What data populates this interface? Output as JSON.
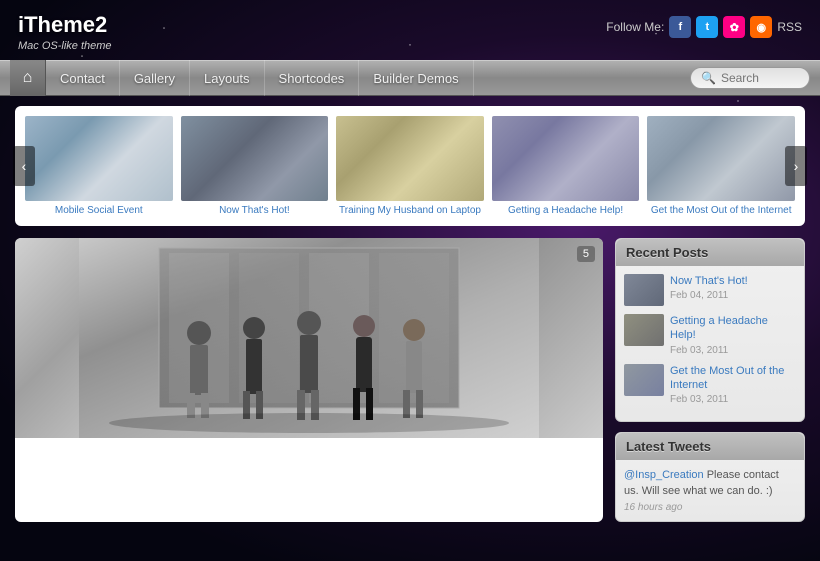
{
  "site": {
    "title": "iTheme2",
    "tagline": "Mac OS-like theme"
  },
  "header": {
    "follow_label": "Follow Me:",
    "social": [
      {
        "name": "Facebook",
        "key": "fb",
        "icon": "f"
      },
      {
        "name": "Twitter",
        "key": "tw",
        "icon": "t"
      },
      {
        "name": "Flickr",
        "key": "fl",
        "icon": "✿"
      },
      {
        "name": "RSS Feed",
        "key": "rss",
        "icon": "◉"
      }
    ],
    "rss_label": "RSS"
  },
  "nav": {
    "home_icon": "⌂",
    "items": [
      "Contact",
      "Gallery",
      "Layouts",
      "Shortcodes",
      "Builder Demos"
    ],
    "search_placeholder": "Search"
  },
  "slideshow": {
    "prev_label": "‹",
    "next_label": "›",
    "slides": [
      {
        "caption": "Mobile Social Event"
      },
      {
        "caption": "Now That's Hot!"
      },
      {
        "caption": "Training My Husband on Laptop"
      },
      {
        "caption": "Getting a Headache Help!"
      },
      {
        "caption": "Get the Most Out of the Internet"
      }
    ]
  },
  "main_post": {
    "badge": "5"
  },
  "sidebar": {
    "recent_posts_title": "Recent Posts",
    "posts": [
      {
        "title": "Now That's Hot!",
        "date": "Feb 04, 2011"
      },
      {
        "title": "Getting a Headache Help!",
        "date": "Feb 03, 2011"
      },
      {
        "title": "Get the Most Out of the Internet",
        "date": "Feb 03, 2011"
      }
    ],
    "tweets_title": "Latest Tweets",
    "tweet": {
      "mention": "@Insp_Creation",
      "text": " Please contact us. Will see what we can do. :)",
      "time": "16 hours ago"
    }
  }
}
